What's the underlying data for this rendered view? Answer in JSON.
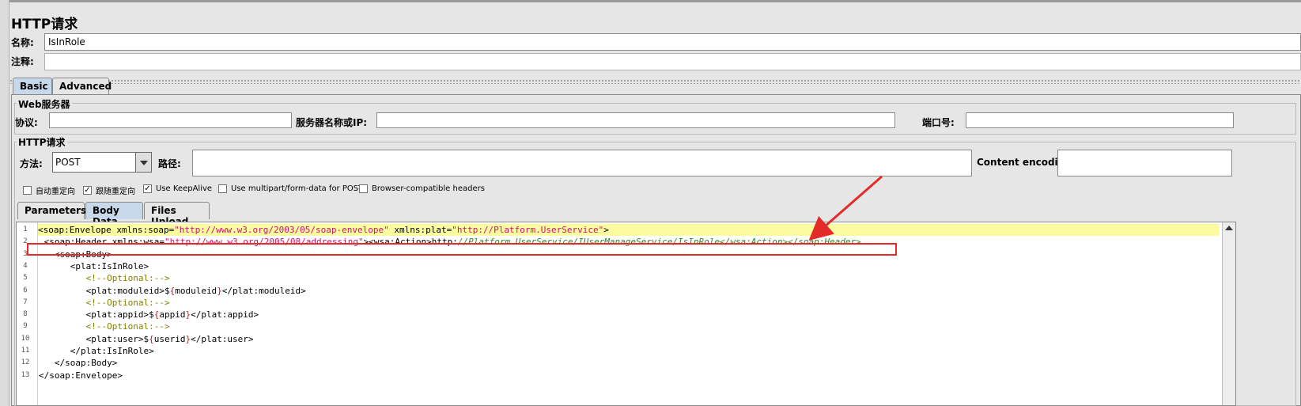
{
  "window": {
    "title": "HTTP请求"
  },
  "form": {
    "name_label": "名称:",
    "name_value": "IsInRole",
    "comment_label": "注释:",
    "comment_value": ""
  },
  "tabs_top": {
    "basic": "Basic",
    "advanced": "Advanced"
  },
  "web_server": {
    "group_title": "Web服务器",
    "protocol_label": "协议:",
    "protocol_value": "",
    "server_label": "服务器名称或IP:",
    "server_value": "",
    "port_label": "端口号:",
    "port_value": ""
  },
  "http_request": {
    "group_title": "HTTP请求",
    "method_label": "方法:",
    "method_value": "POST",
    "path_label": "路径:",
    "path_value": "",
    "encoding_label": "Content encoding:",
    "encoding_value": ""
  },
  "checkboxes": [
    {
      "label": "自动重定向",
      "checked": false
    },
    {
      "label": "跟随重定向",
      "checked": true
    },
    {
      "label": "Use KeepAlive",
      "checked": true
    },
    {
      "label": "Use multipart/form-data for POST",
      "checked": false
    },
    {
      "label": "Browser-compatible headers",
      "checked": false
    }
  ],
  "tabs_body": {
    "parameters": "Parameters",
    "body_data": "Body Data",
    "files_upload": "Files Upload"
  },
  "editor": {
    "lines": [
      {
        "n": "1",
        "seg": [
          [
            "tg",
            "<soap:Envelope xmlns:soap="
          ],
          [
            "av",
            "\"http://www.w3.org/2003/05/soap-envelope\""
          ],
          [
            "tg",
            " xmlns:plat="
          ],
          [
            "av",
            "\"http://Platform.UserService\""
          ],
          [
            "tg",
            ">"
          ]
        ]
      },
      {
        "n": "2",
        "seg": [
          [
            "tg",
            " <soap:Header xmlns:wsa="
          ],
          [
            "av",
            "\"http://www.w3.org/2005/08/addressing\""
          ],
          [
            "tg",
            "><wsa:Action>http:"
          ],
          [
            "it",
            "//Platform.UserService/IUserManageService/IsInRole</wsa:Action></soap:Header>"
          ]
        ]
      },
      {
        "n": "3",
        "seg": [
          [
            "tg",
            "   <soap:Body>"
          ]
        ]
      },
      {
        "n": "4",
        "seg": [
          [
            "tg",
            "      <plat:IsInRole>"
          ]
        ]
      },
      {
        "n": "5",
        "seg": [
          [
            "cm",
            "         <!--Optional:-->"
          ]
        ]
      },
      {
        "n": "6",
        "seg": [
          [
            "tg",
            "         <plat:moduleid>$"
          ],
          [
            "vb",
            "{"
          ],
          [
            "tg",
            "moduleid"
          ],
          [
            "vb",
            "}"
          ],
          [
            "tg",
            "</plat:moduleid>"
          ]
        ]
      },
      {
        "n": "7",
        "seg": [
          [
            "cm",
            "         <!--Optional:-->"
          ]
        ]
      },
      {
        "n": "8",
        "seg": [
          [
            "tg",
            "         <plat:appid>$"
          ],
          [
            "vb",
            "{"
          ],
          [
            "tg",
            "appid"
          ],
          [
            "vb",
            "}"
          ],
          [
            "tg",
            "</plat:appid>"
          ]
        ]
      },
      {
        "n": "9",
        "seg": [
          [
            "cm",
            "         <!--Optional:-->"
          ]
        ]
      },
      {
        "n": "10",
        "seg": [
          [
            "tg",
            "         <plat:user>$"
          ],
          [
            "vb",
            "{"
          ],
          [
            "tg",
            "userid"
          ],
          [
            "vb",
            "}"
          ],
          [
            "tg",
            "</plat:user>"
          ]
        ]
      },
      {
        "n": "11",
        "seg": [
          [
            "tg",
            "      </plat:IsInRole>"
          ]
        ]
      },
      {
        "n": "12",
        "seg": [
          [
            "tg",
            "   </soap:Body>"
          ]
        ]
      },
      {
        "n": "13",
        "seg": [
          [
            "tg",
            "</soap:Envelope>"
          ]
        ]
      }
    ]
  },
  "colors": {
    "annotation": "#e52a2a",
    "active_tab": "#c6d8ea",
    "highlight_line": "#fbfba0"
  }
}
